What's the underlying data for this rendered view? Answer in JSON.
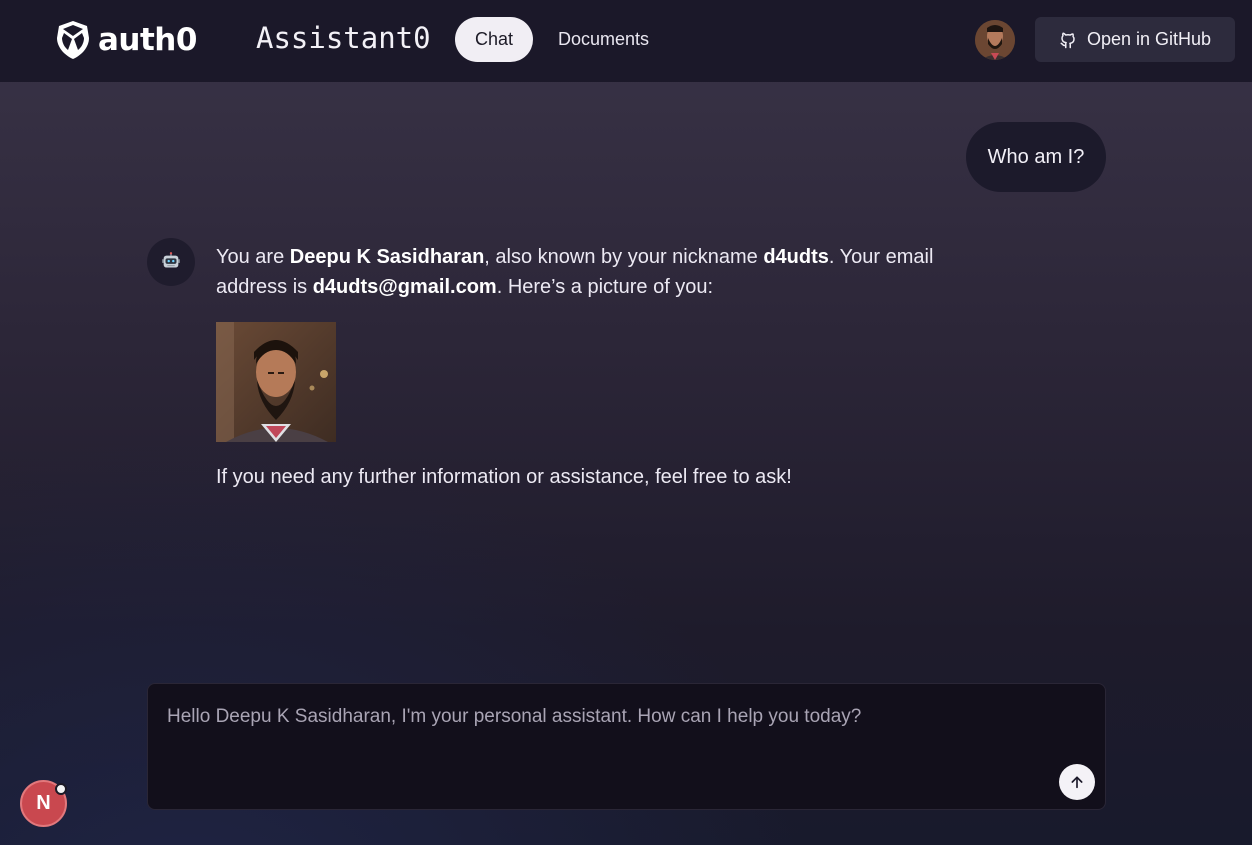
{
  "header": {
    "logo_text": "auth0",
    "app_title": "Assistant0",
    "nav": [
      {
        "label": "Chat",
        "active": true
      },
      {
        "label": "Documents",
        "active": false
      }
    ],
    "github_label": "Open in GitHub"
  },
  "chat": {
    "user_message": "Who am I?",
    "bot_icon": "robot-emoji",
    "bot_message": {
      "t1": "You are ",
      "name": "Deepu K Sasidharan",
      "t2": ", also known by your nickname ",
      "nickname": "d4udts",
      "t3": ". Your email address is ",
      "email": "d4udts@gmail.com",
      "t4": ". Here’s a picture of you:"
    },
    "bot_message_2": "If you need any further information or assistance, feel free to ask!"
  },
  "input": {
    "placeholder": "Hello Deepu K Sasidharan, I'm your personal assistant. How can I help you today?",
    "value": ""
  },
  "dev_badge": {
    "label": "N"
  },
  "colors": {
    "header_bg": "#1b1829",
    "active_tab_bg": "#f1eef4",
    "badge_red": "#c9484f"
  }
}
